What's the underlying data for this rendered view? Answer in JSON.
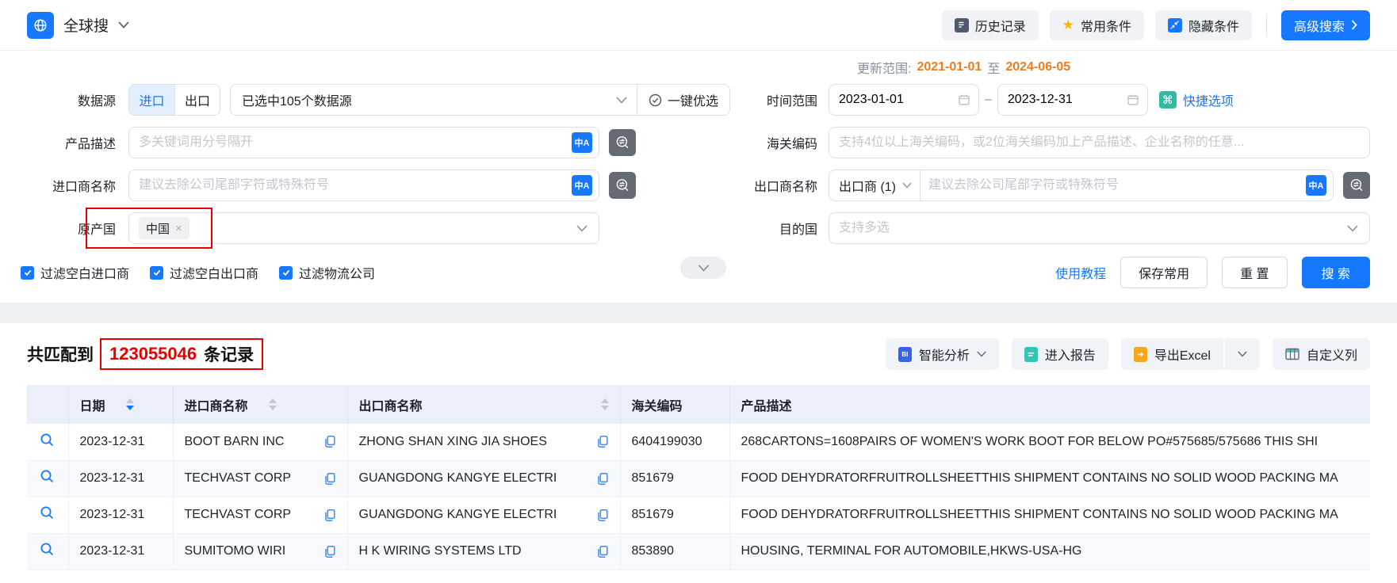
{
  "colors": {
    "primary_blue": "#1677ff",
    "record_red": "#e60000",
    "update_orange": "#f27b1d",
    "star_gold": "#f7b500",
    "quick_teal": "#35b9a5"
  },
  "header": {
    "app_title": "全球搜",
    "history": "历史记录",
    "favorites": "常用条件",
    "hide_conditions": "隐藏条件",
    "advanced_search": "高级搜索"
  },
  "filters": {
    "update_range": {
      "label": "更新范围:",
      "start": "2021-01-01",
      "to": "至",
      "end": "2024-06-05"
    },
    "data_source": {
      "label": "数据源",
      "import_tab": "进口",
      "export_tab": "出口",
      "selected_text": "已选中105个数据源",
      "optimize": "一键优选"
    },
    "time_range": {
      "label": "时间范围",
      "start": "2023-01-01",
      "separator": "–",
      "end": "2023-12-31",
      "quick_options": "快捷选项",
      "cmd_glyph": "⌘"
    },
    "product_desc": {
      "label": "产品描述",
      "placeholder": "多关键词用分号隔开"
    },
    "hs_code": {
      "label": "海关编码",
      "placeholder": "支持4位以上海关编码，或2位海关编码加上产品描述、企业名称的任意..."
    },
    "importer": {
      "label": "进口商名称",
      "placeholder": "建议去除公司尾部字符或特殊符号"
    },
    "exporter": {
      "label": "出口商名称",
      "prefix": "出口商 (1)",
      "placeholder": "建议去除公司尾部字符或特殊符号"
    },
    "origin_country": {
      "label": "原产国",
      "tag": "中国",
      "tag_close": "×"
    },
    "destination": {
      "label": "目的国",
      "placeholder": "支持多选"
    },
    "translate_glyph": "中A",
    "checkboxes": [
      "过滤空白进口商",
      "过滤空白出口商",
      "过滤物流公司"
    ],
    "tutorial_link": "使用教程",
    "save_button": "保存常用",
    "reset_button": "重 置",
    "search_button": "搜 索"
  },
  "results": {
    "match_prefix": "共匹配到",
    "count": "123055046",
    "match_suffix": "条记录",
    "analyze_button": "智能分析",
    "analyze_icon_glyph": "BI",
    "report_button": "进入报告",
    "export_button": "导出Excel",
    "columns_button": "自定义列"
  },
  "table": {
    "headers": {
      "date": "日期",
      "importer": "进口商名称",
      "exporter": "出口商名称",
      "hs_code": "海关编码",
      "product_desc": "产品描述"
    },
    "rows": [
      {
        "date": "2023-12-31",
        "importer": "BOOT BARN INC",
        "exporter": "ZHONG SHAN XING JIA SHOES",
        "hs_code": "6404199030",
        "desc": "268CARTONS=1608PAIRS OF WOMEN'S WORK BOOT FOR BELOW PO#575685/575686 THIS SHI"
      },
      {
        "date": "2023-12-31",
        "importer": "TECHVAST CORP",
        "exporter": "GUANGDONG KANGYE ELECTRI",
        "hs_code": "851679",
        "desc": "FOOD DEHYDRATORFRUITROLLSHEETTHIS SHIPMENT CONTAINS NO SOLID WOOD PACKING MA"
      },
      {
        "date": "2023-12-31",
        "importer": "TECHVAST CORP",
        "exporter": "GUANGDONG KANGYE ELECTRI",
        "hs_code": "851679",
        "desc": "FOOD DEHYDRATORFRUITROLLSHEETTHIS SHIPMENT CONTAINS NO SOLID WOOD PACKING MA"
      },
      {
        "date": "2023-12-31",
        "importer": "SUMITOMO WIRI",
        "exporter": "H K WIRING SYSTEMS LTD",
        "hs_code": "853890",
        "desc": "HOUSING, TERMINAL FOR AUTOMOBILE,HKWS-USA-HG"
      }
    ]
  }
}
